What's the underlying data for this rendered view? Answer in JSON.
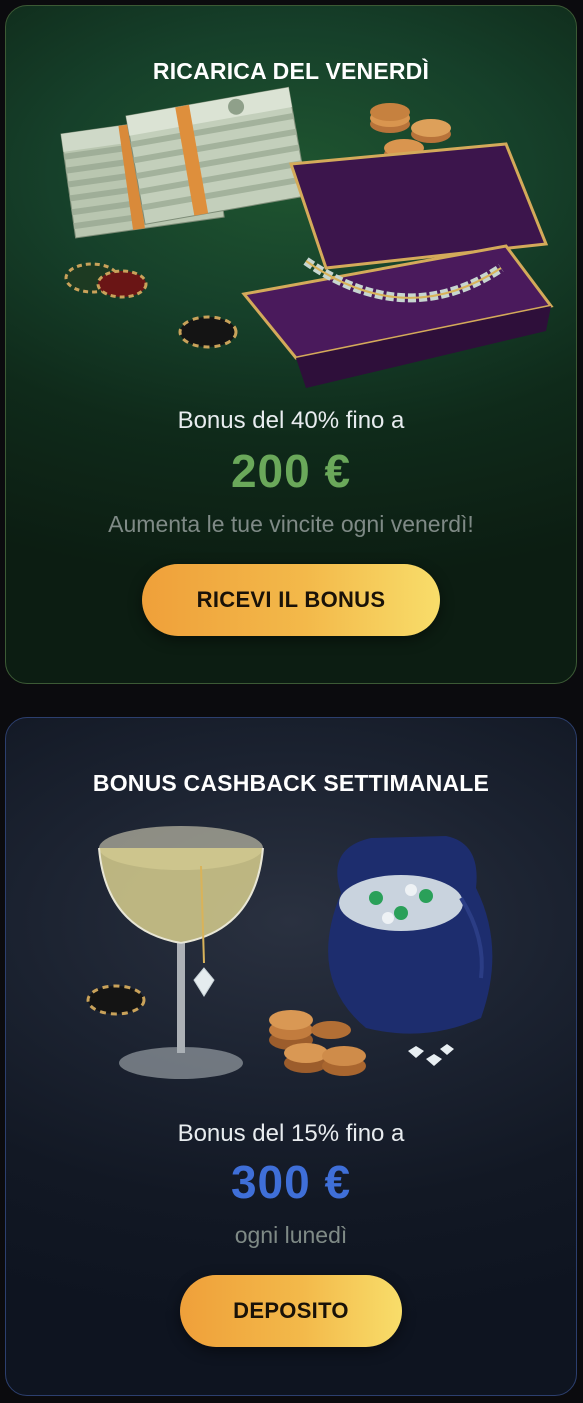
{
  "colors": {
    "green_amount": "#6aa85a",
    "blue_amount": "#3f6fd8",
    "button_gradient_start": "#efa03a",
    "button_gradient_end": "#f8dd6a"
  },
  "promotions": [
    {
      "title": "RICARICA DEL VENERDÌ",
      "subtitle": "Bonus del 40% fino a",
      "amount": "200 €",
      "description": "Aumenta le tue vincite ogni venerdì!",
      "button_label": "RICEVI IL BONUS",
      "illustration_icons": [
        "cash-stacks-icon",
        "poker-chips-icon",
        "gold-coins-icon",
        "jewelry-box-bracelet-icon"
      ]
    },
    {
      "title": "BONUS CASHBACK SETTIMANALE",
      "subtitle": "Bonus del 15% fino a",
      "amount": "300 €",
      "description": "ogni lunedì",
      "button_label": "DEPOSITO",
      "illustration_icons": [
        "champagne-glass-icon",
        "diamond-pendant-icon",
        "poker-chip-icon",
        "gold-coins-icon",
        "velvet-gem-bag-icon",
        "diamonds-icon"
      ]
    }
  ]
}
